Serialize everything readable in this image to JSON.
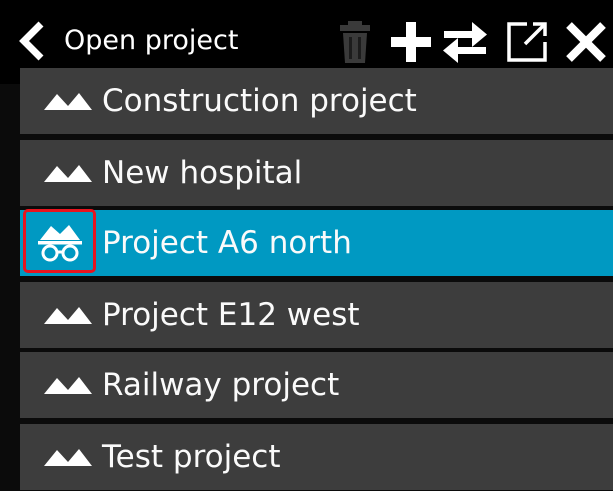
{
  "header": {
    "title": "Open project",
    "icons": {
      "back": "chevron-left-icon",
      "delete": "trash-icon",
      "add": "plus-icon",
      "swap": "swap-arrows-icon",
      "export": "export-icon",
      "close": "close-icon"
    }
  },
  "projects": [
    {
      "label": "Construction project",
      "icon": "mountains-icon",
      "selected": false
    },
    {
      "label": "New hospital",
      "icon": "mountains-icon",
      "selected": false
    },
    {
      "label": "Project A6 north",
      "icon": "mountains-glasses-icon",
      "selected": true
    },
    {
      "label": "Project E12 west",
      "icon": "mountains-icon",
      "selected": false
    },
    {
      "label": "Railway project",
      "icon": "mountains-icon",
      "selected": false
    },
    {
      "label": "Test project",
      "icon": "mountains-icon",
      "selected": false
    }
  ],
  "colors": {
    "header_bg": "#000000",
    "row_bg": "#3d3d3d",
    "selected_bg": "#0099c2",
    "highlight_border": "#e8141e",
    "disabled_icon": "#3a3a3a"
  }
}
